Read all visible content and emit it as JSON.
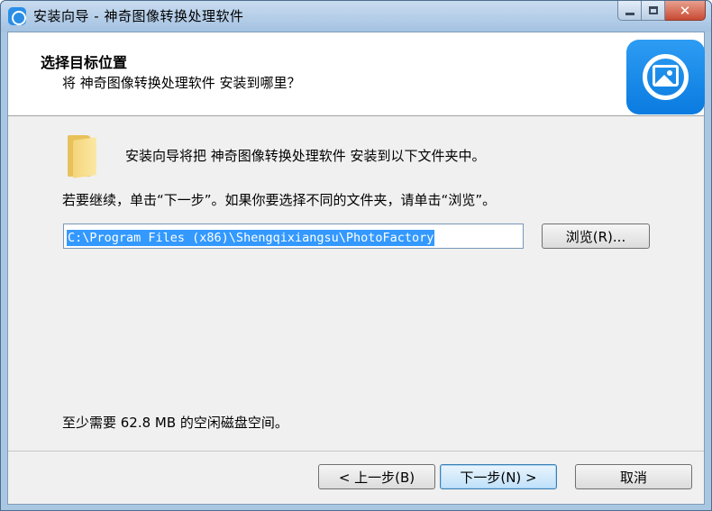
{
  "window": {
    "title": "安装向导 - 神奇图像转换处理软件",
    "controls": {
      "minimize_icon": "minimize-icon",
      "maximize_icon": "maximize-icon",
      "close_icon": "close-icon"
    }
  },
  "header": {
    "title": "选择目标位置",
    "subtitle": "将 神奇图像转换处理软件 安装到哪里？",
    "logo_icon": "image-icon"
  },
  "body": {
    "folder_icon": "folder-icon",
    "intro": "安装向导将把 神奇图像转换处理软件 安装到以下文件夹中。",
    "instruction": "若要继续，单击“下一步”。如果你要选择不同的文件夹，请单击“浏览”。",
    "install_path": "C:\\Program Files (x86)\\Shengqixiangsu\\PhotoFactory",
    "browse_label": "浏览(R)...",
    "space_required": "至少需要 62.8 MB 的空闲磁盘空间。"
  },
  "footer": {
    "back_label": "< 上一步(B)",
    "next_label": "下一步(N) >",
    "cancel_label": "取消"
  },
  "colors": {
    "selection": "#3399ff",
    "logo": "#1a8cf0",
    "titlebar": "#b7d0ea"
  }
}
